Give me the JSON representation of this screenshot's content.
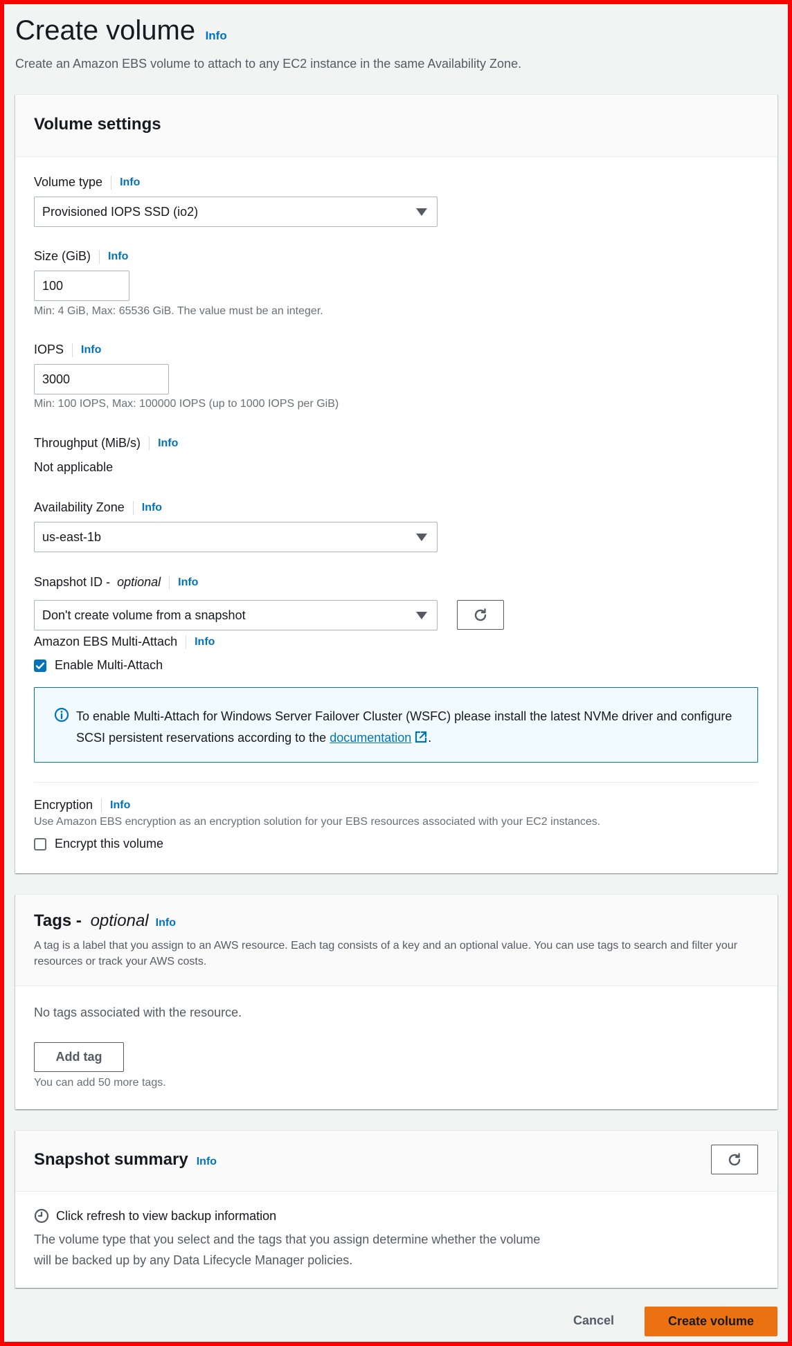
{
  "page": {
    "title": "Create volume",
    "title_info": "Info",
    "description": "Create an Amazon EBS volume to attach to any EC2 instance in the same Availability Zone."
  },
  "volume_settings": {
    "title": "Volume settings",
    "volume_type": {
      "label": "Volume type",
      "info": "Info",
      "value": "Provisioned IOPS SSD (io2)"
    },
    "size": {
      "label": "Size (GiB)",
      "info": "Info",
      "value": "100",
      "hint": "Min: 4 GiB, Max: 65536 GiB. The value must be an integer."
    },
    "iops": {
      "label": "IOPS",
      "info": "Info",
      "value": "3000",
      "hint": "Min: 100 IOPS, Max: 100000 IOPS (up to 1000 IOPS per GiB)"
    },
    "throughput": {
      "label": "Throughput (MiB/s)",
      "info": "Info",
      "value": "Not applicable"
    },
    "availability_zone": {
      "label": "Availability Zone",
      "info": "Info",
      "value": "us-east-1b"
    },
    "snapshot_id": {
      "label": "Snapshot ID - ",
      "label_optional": "optional",
      "info": "Info",
      "value": "Don't create volume from a snapshot"
    },
    "multi_attach": {
      "label": "Amazon EBS Multi-Attach",
      "info": "Info",
      "checkbox_label": "Enable Multi-Attach",
      "checked": true,
      "alert_text": "To enable Multi-Attach for Windows Server Failover Cluster (WSFC) please install the latest NVMe driver and configure SCSI persistent reservations according to the ",
      "alert_link": "documentation",
      "alert_end": "."
    },
    "encryption": {
      "label": "Encryption",
      "info": "Info",
      "description": "Use Amazon EBS encryption as an encryption solution for your EBS resources associated with your EC2 instances.",
      "checkbox_label": "Encrypt this volume",
      "checked": false
    }
  },
  "tags": {
    "title": "Tags - ",
    "title_optional": "optional",
    "info": "Info",
    "description": "A tag is a label that you assign to an AWS resource. Each tag consists of a key and an optional value. You can use tags to search and filter your resources or track your AWS costs.",
    "empty_text": "No tags associated with the resource.",
    "add_button": "Add tag",
    "hint": "You can add 50 more tags."
  },
  "snapshot_summary": {
    "title": "Snapshot summary",
    "info": "Info",
    "status": "Click refresh to view backup information",
    "description": "The volume type that you select and the tags that you assign determine whether the volume will be backed up by any Data Lifecycle Manager policies."
  },
  "footer": {
    "cancel": "Cancel",
    "create": "Create volume"
  },
  "colors": {
    "link": "#0073bb",
    "primary": "#ec7211",
    "frame": "#ff0000",
    "alert_bg": "#f1faff"
  }
}
